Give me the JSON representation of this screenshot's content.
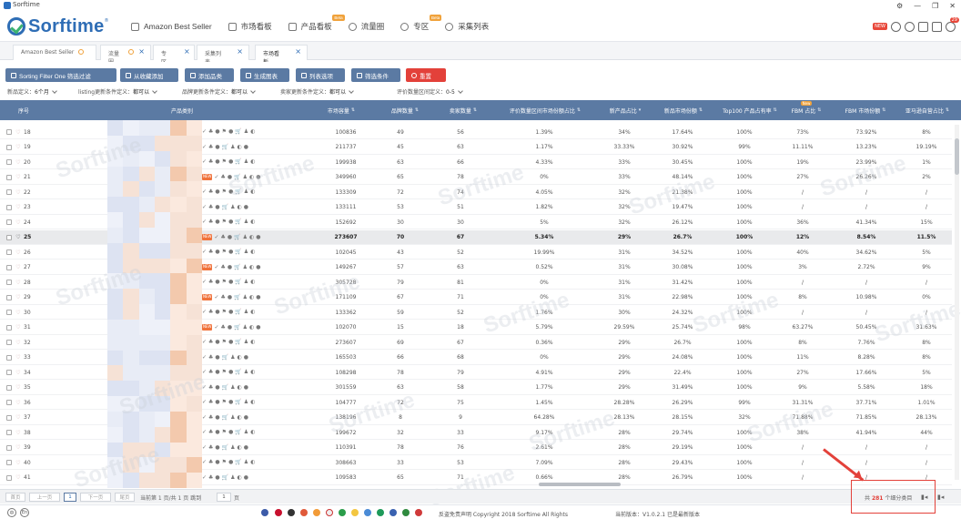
{
  "titlebar": {
    "title": "Sorftime",
    "controls": [
      "⚙",
      "—",
      "❐",
      "✕"
    ]
  },
  "header": {
    "logo": "Sorftime",
    "nav": [
      {
        "label": "Amazon Best Seller",
        "icon": "crown-icon",
        "badge": ""
      },
      {
        "label": "市场看板",
        "icon": "board-icon",
        "badge": ""
      },
      {
        "label": "产品看板",
        "icon": "product-icon",
        "badge": "Beta"
      },
      {
        "label": "流量圈",
        "icon": "traffic-icon",
        "badge": ""
      },
      {
        "label": "专区",
        "icon": "pin-icon",
        "badge": "Beta"
      },
      {
        "label": "采集列表",
        "icon": "cloud-icon",
        "badge": ""
      }
    ],
    "new_badge": "NEW",
    "notification_count": "29"
  },
  "tabs": [
    {
      "label": "Amazon Best Seller",
      "closable": false,
      "loading": true
    },
    {
      "label": "流量圈",
      "closable": true,
      "loading": true
    },
    {
      "label": "专区",
      "closable": true,
      "loading": false
    },
    {
      "label": "采集列表",
      "closable": true,
      "loading": false
    },
    {
      "label": "市场看板",
      "closable": true,
      "loading": false
    }
  ],
  "toolbar": {
    "filter_one": "Sorting Filter One 筛选过滤",
    "from_favorites": "从收藏添加",
    "add_product": "添加品类",
    "generate_chart": "生成图表",
    "list_options": "列表选项",
    "filter_conditions": "筛选条件",
    "reset": "重置"
  },
  "filters": [
    {
      "label": "新品定义：",
      "value": "6个月"
    },
    {
      "label": "listing更新条件定义：",
      "value": "都可以"
    },
    {
      "label": "品牌更新条件定义：",
      "value": "都可以"
    },
    {
      "label": "卖家更新条件定义：",
      "value": "都可以"
    },
    {
      "label": "评价数量区间定义：",
      "value": "0-5"
    }
  ],
  "columns": [
    "序号",
    "产品类别",
    "市场容量",
    "品牌数量",
    "卖家数量",
    "评价数量区间市场份额占比",
    "新产品占比",
    "新品市场份额",
    "Top100 产品占有率",
    "FBM 占比",
    "FBM 市场份额",
    "亚马逊自营占比"
  ],
  "fbm_new_badge": "New",
  "rows": [
    [
      "18",
      "100836",
      "49",
      "56",
      "1.39%",
      "34%",
      "17.64%",
      "100%",
      "73%",
      "73.92%",
      "8%"
    ],
    [
      "19",
      "211737",
      "45",
      "63",
      "1.17%",
      "33.33%",
      "30.92%",
      "99%",
      "11.11%",
      "13.23%",
      "19.19%"
    ],
    [
      "20",
      "199938",
      "63",
      "66",
      "4.33%",
      "33%",
      "30.45%",
      "100%",
      "19%",
      "23.99%",
      "1%"
    ],
    [
      "21",
      "349960",
      "65",
      "78",
      "0%",
      "33%",
      "48.14%",
      "100%",
      "27%",
      "26.26%",
      "2%"
    ],
    [
      "22",
      "133309",
      "72",
      "74",
      "4.05%",
      "32%",
      "21.38%",
      "100%",
      "/",
      "/",
      "/"
    ],
    [
      "23",
      "133111",
      "53",
      "51",
      "1.82%",
      "32%",
      "19.47%",
      "100%",
      "/",
      "/",
      "/"
    ],
    [
      "24",
      "152692",
      "30",
      "30",
      "5%",
      "32%",
      "26.12%",
      "100%",
      "36%",
      "41.34%",
      "15%"
    ],
    [
      "25",
      "273607",
      "70",
      "67",
      "5.34%",
      "29%",
      "26.7%",
      "100%",
      "12%",
      "8.54%",
      "11.5%"
    ],
    [
      "26",
      "102045",
      "43",
      "52",
      "19.99%",
      "31%",
      "34.52%",
      "100%",
      "40%",
      "34.62%",
      "5%"
    ],
    [
      "27",
      "149267",
      "57",
      "63",
      "0.52%",
      "31%",
      "30.08%",
      "100%",
      "3%",
      "2.72%",
      "9%"
    ],
    [
      "28",
      "305728",
      "79",
      "81",
      "0%",
      "31%",
      "31.42%",
      "100%",
      "/",
      "/",
      "/"
    ],
    [
      "29",
      "171109",
      "67",
      "71",
      "0%",
      "31%",
      "22.98%",
      "100%",
      "8%",
      "10.98%",
      "0%"
    ],
    [
      "30",
      "133362",
      "59",
      "52",
      "1.76%",
      "30%",
      "24.32%",
      "100%",
      "/",
      "/",
      "/"
    ],
    [
      "31",
      "102070",
      "15",
      "18",
      "5.79%",
      "29.59%",
      "25.74%",
      "98%",
      "63.27%",
      "50.45%",
      "31.63%"
    ],
    [
      "32",
      "273607",
      "69",
      "67",
      "0.36%",
      "29%",
      "26.7%",
      "100%",
      "8%",
      "7.76%",
      "8%"
    ],
    [
      "33",
      "165503",
      "66",
      "68",
      "0%",
      "29%",
      "24.08%",
      "100%",
      "11%",
      "8.28%",
      "8%"
    ],
    [
      "34",
      "108298",
      "78",
      "79",
      "4.91%",
      "29%",
      "22.4%",
      "100%",
      "27%",
      "17.66%",
      "5%"
    ],
    [
      "35",
      "301559",
      "63",
      "58",
      "1.77%",
      "29%",
      "31.49%",
      "100%",
      "9%",
      "5.58%",
      "18%"
    ],
    [
      "36",
      "104777",
      "72",
      "75",
      "1.45%",
      "28.28%",
      "26.29%",
      "99%",
      "31.31%",
      "37.71%",
      "1.01%"
    ],
    [
      "37",
      "138196",
      "8",
      "9",
      "64.28%",
      "28.13%",
      "28.15%",
      "32%",
      "71.88%",
      "71.85%",
      "28.13%"
    ],
    [
      "38",
      "199672",
      "32",
      "33",
      "9.17%",
      "28%",
      "29.74%",
      "100%",
      "38%",
      "41.94%",
      "44%"
    ],
    [
      "39",
      "110391",
      "78",
      "76",
      "2.61%",
      "28%",
      "29.19%",
      "100%",
      "/",
      "/",
      "/"
    ],
    [
      "40",
      "308663",
      "33",
      "53",
      "7.09%",
      "28%",
      "29.43%",
      "100%",
      "/",
      "/",
      "/"
    ],
    [
      "41",
      "109583",
      "65",
      "71",
      "0.66%",
      "28%",
      "26.79%",
      "100%",
      "/",
      "/",
      "/"
    ]
  ],
  "highlighted_row": "25",
  "pager": {
    "first": "首页",
    "prev": "上一页",
    "page": "1",
    "next": "下一页",
    "last": "尾页",
    "info": "当前第 1 页/共 1 页 跳到",
    "goto_value": "1",
    "goto_unit": "页",
    "total_prefix": "共",
    "total_count": "281",
    "total_suffix": "个细分类目"
  },
  "footer": {
    "lang_cn": "中",
    "lang_en": "En",
    "disclaimer": "反盗免责声明 Copyright 2018 Sorftime All Rights",
    "version": "当前版本：V1.0.2.1  已是最新版本"
  },
  "watermark_text": "Sorftime"
}
